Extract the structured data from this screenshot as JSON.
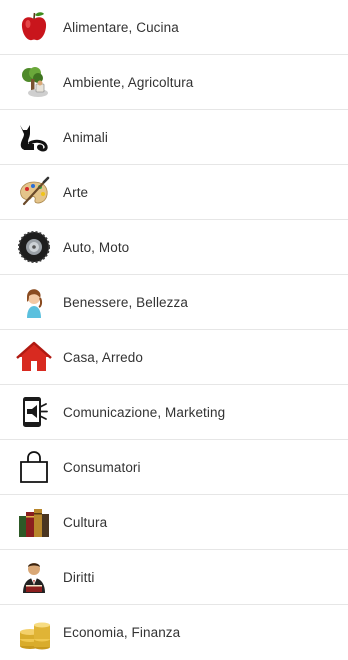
{
  "categories": [
    {
      "label": "Alimentare, Cucina",
      "icon": "apple-icon"
    },
    {
      "label": "Ambiente, Agricoltura",
      "icon": "tree-icon"
    },
    {
      "label": "Animali",
      "icon": "cat-icon"
    },
    {
      "label": "Arte",
      "icon": "palette-icon"
    },
    {
      "label": "Auto, Moto",
      "icon": "tire-icon"
    },
    {
      "label": "Benessere, Bellezza",
      "icon": "woman-icon"
    },
    {
      "label": "Casa, Arredo",
      "icon": "house-icon"
    },
    {
      "label": "Comunicazione, Marketing",
      "icon": "megaphone-phone-icon"
    },
    {
      "label": "Consumatori",
      "icon": "shopping-bag-icon"
    },
    {
      "label": "Cultura",
      "icon": "books-icon"
    },
    {
      "label": "Diritti",
      "icon": "reader-icon"
    },
    {
      "label": "Economia, Finanza",
      "icon": "coins-icon"
    }
  ]
}
